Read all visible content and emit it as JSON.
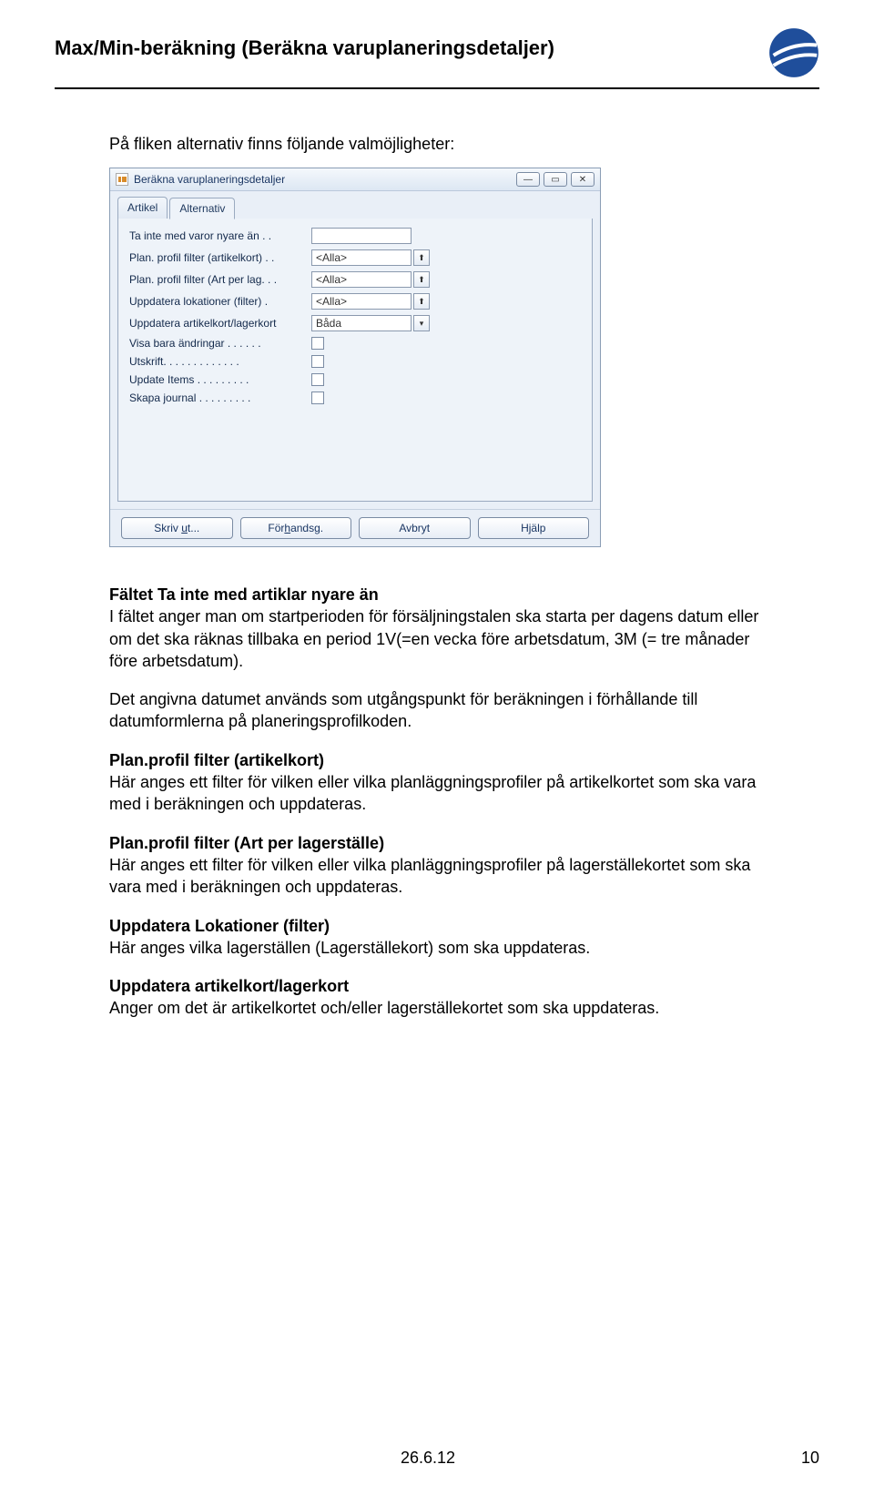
{
  "header": {
    "title": "Max/Min-beräkning (Beräkna varuplaneringsdetaljer)"
  },
  "intro": "På fliken alternativ finns följande valmöjligheter:",
  "window": {
    "title": "Beräkna varuplaneringsdetaljer",
    "win_min": "―",
    "win_max": "▭",
    "win_close": "✕",
    "tabs": {
      "artikel": "Artikel",
      "alternativ": "Alternativ"
    },
    "rows": {
      "r1": {
        "label": "Ta inte med varor nyare än  .  ."
      },
      "r2": {
        "label": "Plan. profil filter (artikelkort) .  .",
        "value": "<Alla>"
      },
      "r3": {
        "label": "Plan. profil filter (Art per lag. . .",
        "value": "<Alla>"
      },
      "r4": {
        "label": "Uppdatera lokationer (filter)  .",
        "value": "<Alla>"
      },
      "r5": {
        "label": "Uppdatera artikelkort/lagerkort",
        "value": "Båda"
      },
      "r6": {
        "label": "Visa bara ändringar  .  .  .  .  .  ."
      },
      "r7": {
        "label": "Utskrift.  .  .  .  .  .  .  .  .  .  .  .  ."
      },
      "r8": {
        "label": "Update Items .  .  .  .  .  .  .  .  ."
      },
      "r9": {
        "label": "Skapa journal .  .  .  .  .  .  .  .  ."
      }
    },
    "buttons": {
      "print_pre": "Skriv ",
      "print_key": "u",
      "print_post": "t...",
      "preview_pre": "För",
      "preview_key": "h",
      "preview_post": "andsg.",
      "cancel": "Avbryt",
      "help": "Hjälp"
    }
  },
  "body": {
    "p1_title": "Fältet Ta inte med artiklar nyare än",
    "p1_text": "I fältet anger man om startperioden för försäljningstalen ska starta per dagens datum eller om det ska räknas tillbaka en period 1V(=en vecka före arbetsdatum, 3M (= tre månader före arbetsdatum).",
    "p2_text": "Det angivna datumet används som utgångspunkt för beräkningen i förhållande till datumformlerna på planeringsprofilkoden.",
    "p3_title": "Plan.profil filter (artikelkort)",
    "p3_text": "Här anges ett filter för vilken eller vilka planläggningsprofiler på artikelkortet som ska vara med i beräkningen och uppdateras.",
    "p4_title": "Plan.profil filter (Art per lagerställe)",
    "p4_text": "Här anges ett filter för vilken eller vilka planläggningsprofiler på lagerställekortet som ska vara med i beräkningen och uppdateras.",
    "p5_title": "Uppdatera Lokationer (filter)",
    "p5_text": "Här anges vilka lagerställen (Lagerställekort) som ska uppdateras.",
    "p6_title": "Uppdatera artikelkort/lagerkort",
    "p6_text": "Anger om det är artikelkortet och/eller lagerställekortet som ska uppdateras."
  },
  "footer": {
    "date": "26.6.12",
    "page": "10"
  }
}
